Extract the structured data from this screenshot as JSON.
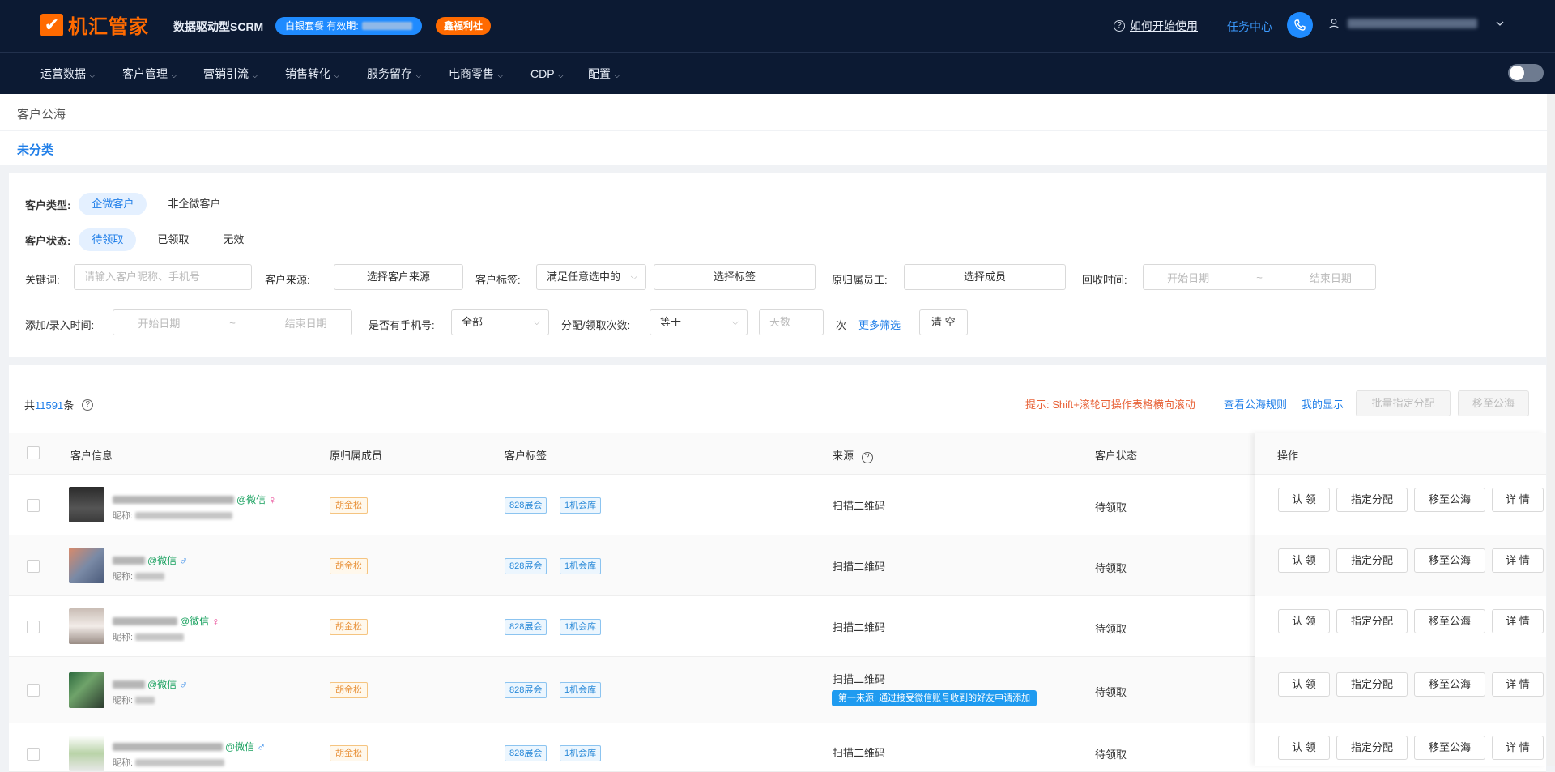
{
  "header": {
    "logo_mark": "✔",
    "logo_text": "机汇管家",
    "subtitle": "数据驱动型SCRM",
    "package_label": "白银套餐  有效期:",
    "welfare_label": "鑫福利社",
    "help_label": "如何开始使用",
    "task_center": "任务中心"
  },
  "nav": {
    "items": [
      "运营数据",
      "客户管理",
      "营销引流",
      "销售转化",
      "服务留存",
      "电商零售",
      "CDP",
      "配置"
    ]
  },
  "breadcrumb": "客户公海",
  "category": "未分类",
  "filters": {
    "customer_type_label": "客户类型:",
    "customer_type_options": [
      "企微客户",
      "非企微客户"
    ],
    "customer_status_label": "客户状态:",
    "customer_status_options": [
      "待领取",
      "已领取",
      "无效"
    ],
    "keyword_label": "关键词:",
    "keyword_placeholder": "请输入客户昵称、手机号",
    "source_label": "客户来源:",
    "source_button": "选择客户来源",
    "tag_label": "客户标签:",
    "tag_mode": "满足任意选中的",
    "tag_button": "选择标签",
    "owner_label": "原归属员工:",
    "owner_button": "选择成员",
    "recycle_label": "回收时间:",
    "start_date": "开始日期",
    "date_sep": "~",
    "end_date": "结束日期",
    "add_time_label": "添加/录入时间:",
    "phone_label": "是否有手机号:",
    "phone_value": "全部",
    "assign_label": "分配/领取次数:",
    "assign_op": "等于",
    "days_placeholder": "天数",
    "times_unit": "次",
    "more_filter": "更多筛选",
    "clear": "清 空"
  },
  "list": {
    "total_prefix": "共",
    "total_count": "11591",
    "total_suffix": "条",
    "hint": "提示: Shift+滚轮可操作表格横向滚动",
    "view_rules": "查看公海规则",
    "my_display": "我的显示",
    "batch_assign": "批量指定分配",
    "move_to_pool": "移至公海"
  },
  "table": {
    "headers": [
      "客户信息",
      "原归属成员",
      "客户标签",
      "来源",
      "客户状态",
      "操作"
    ],
    "rows": [
      {
        "wechat": "@微信",
        "gender": "♀",
        "nick_label": "昵称:",
        "owner": "胡金松",
        "tags": [
          "828展会",
          "1机会库"
        ],
        "source": "扫描二维码",
        "source_tag": "",
        "status": "待领取"
      },
      {
        "wechat": "@微信",
        "gender": "♂",
        "nick_label": "昵称:",
        "owner": "胡金松",
        "tags": [
          "828展会",
          "1机会库"
        ],
        "source": "扫描二维码",
        "source_tag": "",
        "status": "待领取"
      },
      {
        "wechat": "@微信",
        "gender": "♀",
        "nick_label": "昵称:",
        "owner": "胡金松",
        "tags": [
          "828展会",
          "1机会库"
        ],
        "source": "扫描二维码",
        "source_tag": "",
        "status": "待领取"
      },
      {
        "wechat": "@微信",
        "gender": "♂",
        "nick_label": "昵称:",
        "owner": "胡金松",
        "tags": [
          "828展会",
          "1机会库"
        ],
        "source": "扫描二维码",
        "source_tag": "第一来源: 通过接受微信账号收到的好友申请添加",
        "status": "待领取"
      },
      {
        "wechat": "@微信",
        "gender": "♂",
        "nick_label": "昵称:",
        "owner": "胡金松",
        "tags": [
          "828展会",
          "1机会库"
        ],
        "source": "扫描二维码",
        "source_tag": "",
        "status": "待领取"
      }
    ],
    "ops": [
      "认 领",
      "指定分配",
      "移至公海",
      "详 情"
    ]
  },
  "colors": {
    "topbar": "#0c1a33",
    "brand_orange": "#ff6a00",
    "accent_blue": "#1f7ee8"
  }
}
